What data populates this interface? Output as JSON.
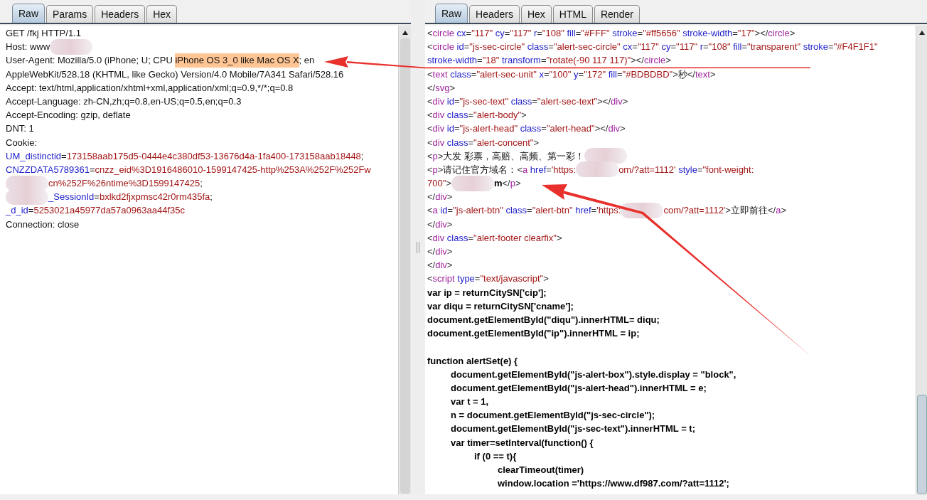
{
  "request": {
    "tabs": [
      {
        "label": "Raw",
        "selected": true
      },
      {
        "label": "Params",
        "selected": false
      },
      {
        "label": "Headers",
        "selected": false
      },
      {
        "label": "Hex",
        "selected": false
      }
    ],
    "lines": [
      [
        {
          "kind": "text",
          "text": "GET /fkj HTTP/1.1"
        }
      ],
      [
        {
          "kind": "text",
          "text": "Host: www"
        },
        {
          "kind": "blur"
        }
      ],
      [
        {
          "kind": "text",
          "text": "User-Agent: Mozilla/5.0 (iPhone; U; CPU "
        },
        {
          "kind": "highlight",
          "text": "iPhone OS 3_0 like Mac OS X"
        },
        {
          "kind": "text",
          "text": "; en"
        }
      ],
      [
        {
          "kind": "text",
          "text": "AppleWebKit/528.18 (KHTML, like Gecko) Version/4.0 Mobile/7A341 Safari/528.16"
        }
      ],
      [
        {
          "kind": "text",
          "text": "Accept: text/html,application/xhtml+xml,application/xml;q=0.9,*/*;q=0.8"
        }
      ],
      [
        {
          "kind": "text",
          "text": "Accept-Language: zh-CN,zh;q=0.8,en-US;q=0.5,en;q=0.3"
        }
      ],
      [
        {
          "kind": "text",
          "text": "Accept-Encoding: gzip, deflate"
        }
      ],
      [
        {
          "kind": "text",
          "text": "DNT: 1"
        }
      ],
      [
        {
          "kind": "text",
          "text": "Cookie:"
        }
      ],
      [
        {
          "kind": "attr",
          "text": "UM_distinctid"
        },
        {
          "kind": "text",
          "text": "="
        },
        {
          "kind": "value",
          "text": "173158aab175d5-0444e4c380df53-13676d4a-1fa400-173158aab18448"
        },
        {
          "kind": "text",
          "text": ";"
        }
      ],
      [
        {
          "kind": "attr",
          "text": "CNZZDATA5789361"
        },
        {
          "kind": "text",
          "text": "="
        },
        {
          "kind": "value",
          "text": "cnzz_eid%3D1916486010-1599147425-http%253A%252F%252Fw"
        }
      ],
      [
        {
          "kind": "blur"
        },
        {
          "kind": "value",
          "text": "cn%252F%26ntime%3D1599147425"
        },
        {
          "kind": "text",
          "text": ";"
        }
      ],
      [
        {
          "kind": "blur"
        },
        {
          "kind": "attr",
          "text": "_SessionId"
        },
        {
          "kind": "text",
          "text": "="
        },
        {
          "kind": "value",
          "text": "bxlkd2fjxpmsc42r0rm435fa"
        },
        {
          "kind": "text",
          "text": ";"
        }
      ],
      [
        {
          "kind": "attr",
          "text": "_d_id"
        },
        {
          "kind": "text",
          "text": "="
        },
        {
          "kind": "value",
          "text": "5253021a45977da57a0963aa44f35c"
        }
      ],
      [
        {
          "kind": "text",
          "text": "Connection: close"
        }
      ]
    ]
  },
  "response": {
    "tabs": [
      {
        "label": "Raw",
        "selected": true
      },
      {
        "label": "Headers",
        "selected": false
      },
      {
        "label": "Hex",
        "selected": false
      },
      {
        "label": "HTML",
        "selected": false
      },
      {
        "label": "Render",
        "selected": false
      }
    ],
    "markup_lines": [
      [
        {
          "kind": "punct",
          "text": "<"
        },
        {
          "kind": "tag",
          "text": "circle"
        },
        {
          "kind": "attr",
          "text": " cx"
        },
        {
          "kind": "punct",
          "text": "="
        },
        {
          "kind": "value",
          "text": "\"117\""
        },
        {
          "kind": "attr",
          "text": " cy"
        },
        {
          "kind": "punct",
          "text": "="
        },
        {
          "kind": "value",
          "text": "\"117\""
        },
        {
          "kind": "attr",
          "text": " r"
        },
        {
          "kind": "punct",
          "text": "="
        },
        {
          "kind": "value",
          "text": "\"108\""
        },
        {
          "kind": "attr",
          "text": " fill"
        },
        {
          "kind": "punct",
          "text": "="
        },
        {
          "kind": "value",
          "text": "\"#FFF\""
        },
        {
          "kind": "attr",
          "text": " stroke"
        },
        {
          "kind": "punct",
          "text": "="
        },
        {
          "kind": "value",
          "text": "\"#ff5656\""
        },
        {
          "kind": "attr",
          "text": " stroke-width"
        },
        {
          "kind": "punct",
          "text": "="
        },
        {
          "kind": "value",
          "text": "\"17\""
        },
        {
          "kind": "punct",
          "text": "></"
        },
        {
          "kind": "tag",
          "text": "circle"
        },
        {
          "kind": "punct",
          "text": ">"
        }
      ],
      [
        {
          "kind": "punct",
          "text": "<"
        },
        {
          "kind": "tag",
          "text": "circle"
        },
        {
          "kind": "attr",
          "text": " id"
        },
        {
          "kind": "punct",
          "text": "="
        },
        {
          "kind": "value",
          "text": "\"js-sec-circle\""
        },
        {
          "kind": "attr",
          "text": " class"
        },
        {
          "kind": "punct",
          "text": "="
        },
        {
          "kind": "value",
          "text": "\"alert-sec-circle\""
        },
        {
          "kind": "attr",
          "text": " cx"
        },
        {
          "kind": "punct",
          "text": "="
        },
        {
          "kind": "value",
          "text": "\"117\""
        },
        {
          "kind": "attr",
          "text": " cy"
        },
        {
          "kind": "punct",
          "text": "="
        },
        {
          "kind": "value",
          "text": "\"117\""
        },
        {
          "kind": "attr",
          "text": " r"
        },
        {
          "kind": "punct",
          "text": "="
        },
        {
          "kind": "value",
          "text": "\"108\""
        },
        {
          "kind": "attr",
          "text": " fill"
        },
        {
          "kind": "punct",
          "text": "="
        },
        {
          "kind": "value",
          "text": "\"transparent\""
        },
        {
          "kind": "attr",
          "text": " stroke"
        },
        {
          "kind": "punct",
          "text": "="
        },
        {
          "kind": "value",
          "text": "\"#F4F1F1\""
        }
      ],
      [
        {
          "kind": "attr",
          "text": "stroke-width"
        },
        {
          "kind": "punct",
          "text": "="
        },
        {
          "kind": "value",
          "text": "\"18\""
        },
        {
          "kind": "attr",
          "text": " transform"
        },
        {
          "kind": "punct",
          "text": "="
        },
        {
          "kind": "value",
          "text": "\"rotate(-90 117 117)\""
        },
        {
          "kind": "punct",
          "text": "></"
        },
        {
          "kind": "tag",
          "text": "circle"
        },
        {
          "kind": "punct",
          "text": ">"
        }
      ],
      [
        {
          "kind": "punct",
          "text": "<"
        },
        {
          "kind": "tag",
          "text": "text"
        },
        {
          "kind": "attr",
          "text": " class"
        },
        {
          "kind": "punct",
          "text": "="
        },
        {
          "kind": "value",
          "text": "\"alert-sec-unit\""
        },
        {
          "kind": "attr",
          "text": " x"
        },
        {
          "kind": "punct",
          "text": "="
        },
        {
          "kind": "value",
          "text": "\"100\""
        },
        {
          "kind": "attr",
          "text": " y"
        },
        {
          "kind": "punct",
          "text": "="
        },
        {
          "kind": "value",
          "text": "\"172\""
        },
        {
          "kind": "attr",
          "text": " fill"
        },
        {
          "kind": "punct",
          "text": "="
        },
        {
          "kind": "value",
          "text": "\"#BDBDBD\""
        },
        {
          "kind": "punct",
          "text": ">"
        },
        {
          "kind": "text",
          "text": "秒"
        },
        {
          "kind": "punct",
          "text": "</"
        },
        {
          "kind": "tag",
          "text": "text"
        },
        {
          "kind": "punct",
          "text": ">"
        }
      ],
      [
        {
          "kind": "punct",
          "text": "</"
        },
        {
          "kind": "tag",
          "text": "svg"
        },
        {
          "kind": "punct",
          "text": ">"
        }
      ],
      [
        {
          "kind": "punct",
          "text": "<"
        },
        {
          "kind": "tag",
          "text": "div"
        },
        {
          "kind": "attr",
          "text": " id"
        },
        {
          "kind": "punct",
          "text": "="
        },
        {
          "kind": "value",
          "text": "\"js-sec-text\""
        },
        {
          "kind": "attr",
          "text": " class"
        },
        {
          "kind": "punct",
          "text": "="
        },
        {
          "kind": "value",
          "text": "\"alert-sec-text\""
        },
        {
          "kind": "punct",
          "text": "></"
        },
        {
          "kind": "tag",
          "text": "div"
        },
        {
          "kind": "punct",
          "text": ">"
        }
      ],
      [
        {
          "kind": "punct",
          "text": "<"
        },
        {
          "kind": "tag",
          "text": "div"
        },
        {
          "kind": "attr",
          "text": " class"
        },
        {
          "kind": "punct",
          "text": "="
        },
        {
          "kind": "value",
          "text": "\"alert-body\""
        },
        {
          "kind": "punct",
          "text": ">"
        }
      ],
      [
        {
          "kind": "punct",
          "text": "<"
        },
        {
          "kind": "tag",
          "text": "div"
        },
        {
          "kind": "attr",
          "text": " id"
        },
        {
          "kind": "punct",
          "text": "="
        },
        {
          "kind": "value",
          "text": "\"js-alert-head\""
        },
        {
          "kind": "attr",
          "text": " class"
        },
        {
          "kind": "punct",
          "text": "="
        },
        {
          "kind": "value",
          "text": "\"alert-head\""
        },
        {
          "kind": "punct",
          "text": "></"
        },
        {
          "kind": "tag",
          "text": "div"
        },
        {
          "kind": "punct",
          "text": ">"
        }
      ],
      [
        {
          "kind": "punct",
          "text": "<"
        },
        {
          "kind": "tag",
          "text": "div"
        },
        {
          "kind": "attr",
          "text": " class"
        },
        {
          "kind": "punct",
          "text": "="
        },
        {
          "kind": "value",
          "text": "\"alert-concent\""
        },
        {
          "kind": "punct",
          "text": ">"
        }
      ],
      [
        {
          "kind": "punct",
          "text": "<"
        },
        {
          "kind": "tag",
          "text": "p"
        },
        {
          "kind": "punct",
          "text": ">"
        },
        {
          "kind": "text",
          "text": "大发 彩票，高赔、高频、第一彩！"
        },
        {
          "kind": "blur"
        }
      ],
      [
        {
          "kind": "punct",
          "text": "<"
        },
        {
          "kind": "tag",
          "text": "p"
        },
        {
          "kind": "punct",
          "text": ">"
        },
        {
          "kind": "text",
          "text": "请记住官方域名："
        },
        {
          "kind": "punct",
          "text": "<"
        },
        {
          "kind": "tag",
          "text": "a"
        },
        {
          "kind": "attr",
          "text": " href"
        },
        {
          "kind": "punct",
          "text": "="
        },
        {
          "kind": "value",
          "text": "'https:"
        },
        {
          "kind": "blur"
        },
        {
          "kind": "value",
          "text": "om/?att=1112'"
        },
        {
          "kind": "attr",
          "text": " style"
        },
        {
          "kind": "punct",
          "text": "="
        },
        {
          "kind": "value",
          "text": "\"font-weight:"
        }
      ],
      [
        {
          "kind": "value",
          "text": "700\""
        },
        {
          "kind": "punct",
          "text": ">"
        },
        {
          "kind": "blur"
        },
        {
          "kind": "bold",
          "text": "m"
        },
        {
          "kind": "punct",
          "text": "</"
        },
        {
          "kind": "tag",
          "text": "p"
        },
        {
          "kind": "punct",
          "text": ">"
        }
      ],
      [
        {
          "kind": "punct",
          "text": "</"
        },
        {
          "kind": "tag",
          "text": "div"
        },
        {
          "kind": "punct",
          "text": ">"
        }
      ],
      [
        {
          "kind": "punct",
          "text": "<"
        },
        {
          "kind": "tag",
          "text": "a"
        },
        {
          "kind": "attr",
          "text": " id"
        },
        {
          "kind": "punct",
          "text": "="
        },
        {
          "kind": "value",
          "text": "\"js-alert-btn\""
        },
        {
          "kind": "attr",
          "text": " class"
        },
        {
          "kind": "punct",
          "text": "="
        },
        {
          "kind": "value",
          "text": "\"alert-btn\""
        },
        {
          "kind": "attr",
          "text": " href"
        },
        {
          "kind": "punct",
          "text": "="
        },
        {
          "kind": "value",
          "text": "'https:"
        },
        {
          "kind": "blur"
        },
        {
          "kind": "value",
          "text": "com/?att=1112'"
        },
        {
          "kind": "punct",
          "text": ">"
        },
        {
          "kind": "text",
          "text": "立即前往"
        },
        {
          "kind": "punct",
          "text": "</"
        },
        {
          "kind": "tag",
          "text": "a"
        },
        {
          "kind": "punct",
          "text": ">"
        }
      ],
      [
        {
          "kind": "punct",
          "text": "</"
        },
        {
          "kind": "tag",
          "text": "div"
        },
        {
          "kind": "punct",
          "text": ">"
        }
      ],
      [
        {
          "kind": "punct",
          "text": "<"
        },
        {
          "kind": "tag",
          "text": "div"
        },
        {
          "kind": "attr",
          "text": " class"
        },
        {
          "kind": "punct",
          "text": "="
        },
        {
          "kind": "value",
          "text": "\"alert-footer clearfix\""
        },
        {
          "kind": "punct",
          "text": ">"
        }
      ],
      [
        {
          "kind": "punct",
          "text": "</"
        },
        {
          "kind": "tag",
          "text": "div"
        },
        {
          "kind": "punct",
          "text": ">"
        }
      ],
      [
        {
          "kind": "punct",
          "text": "</"
        },
        {
          "kind": "tag",
          "text": "div"
        },
        {
          "kind": "punct",
          "text": ">"
        }
      ],
      [
        {
          "kind": "punct",
          "text": "<"
        },
        {
          "kind": "tag",
          "text": "script"
        },
        {
          "kind": "attr",
          "text": " type"
        },
        {
          "kind": "punct",
          "text": "="
        },
        {
          "kind": "value",
          "text": "\"text/javascript\""
        },
        {
          "kind": "punct",
          "text": ">"
        }
      ]
    ],
    "statements": [
      "var ip = returnCitySN['cip'];",
      "var diqu = returnCitySN['cname'];",
      "document.getElementById(\"diqu\").innerHTML= diqu;",
      "document.getElementById(\"ip\").innerHTML = ip;"
    ],
    "functions": [
      {
        "text": "function alertSet(e) {",
        "children": [
          {
            "text": "document.getElementById(\"js-alert-box\").style.display = \"block\","
          },
          {
            "text": "document.getElementById(\"js-alert-head\").innerHTML = e;"
          },
          {
            "text": "var t = 1,"
          },
          {
            "text": "n = document.getElementById(\"js-sec-circle\");"
          },
          {
            "text": "document.getElementById(\"js-sec-text\").innerHTML = t;"
          },
          {
            "text": "var timer=setInterval(function() {",
            "children": [
              {
                "text": "if (0 == t){",
                "children": [
                  {
                    "text": "clearTimeout(timer)"
                  },
                  {
                    "text": "window.location ='https://www.df987.com/?att=1112';"
                  }
                ]
              }
            ]
          }
        ]
      }
    ]
  }
}
